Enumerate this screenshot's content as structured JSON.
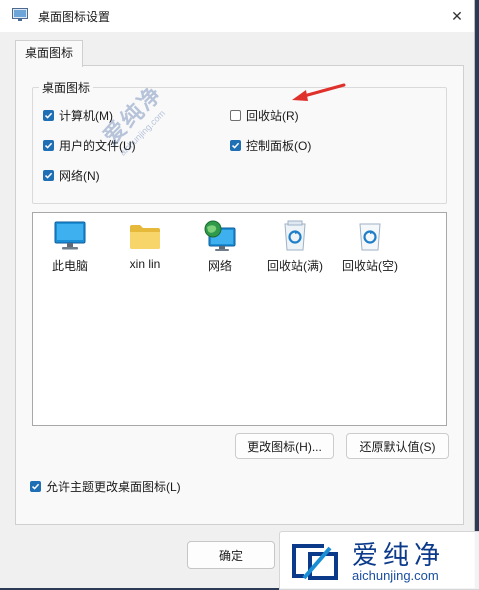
{
  "window": {
    "title": "桌面图标设置",
    "close_glyph": "✕"
  },
  "tab": {
    "label": "桌面图标"
  },
  "group": {
    "legend": "桌面图标",
    "checkboxes": [
      {
        "label": "计算机(M)",
        "checked": true
      },
      {
        "label": "回收站(R)",
        "checked": false
      },
      {
        "label": "用户的文件(U)",
        "checked": true
      },
      {
        "label": "控制面板(O)",
        "checked": true
      },
      {
        "label": "网络(N)",
        "checked": true
      }
    ]
  },
  "icons": [
    {
      "label": "此电脑",
      "icon": "monitor-icon"
    },
    {
      "label": "xin lin",
      "icon": "folder-icon"
    },
    {
      "label": "网络",
      "icon": "network-icon"
    },
    {
      "label": "回收站(满)",
      "icon": "recycle-bin-full-icon"
    },
    {
      "label": "回收站(空)",
      "icon": "recycle-bin-empty-icon"
    }
  ],
  "buttons": {
    "change_icon": "更改图标(H)...",
    "restore_default": "还原默认值(S)",
    "ok": "确定"
  },
  "allow_themes": {
    "label": "允许主题更改桌面图标(L)",
    "checked": true
  },
  "watermark": {
    "small_text": "爱纯净",
    "small_domain": "aichunjing.com",
    "brand": "爱纯净",
    "domain": "aichunjing.com"
  },
  "colors": {
    "accent": "#1f6fb5",
    "arrow": "#e0302b",
    "watermark": "#0c3a8a"
  }
}
